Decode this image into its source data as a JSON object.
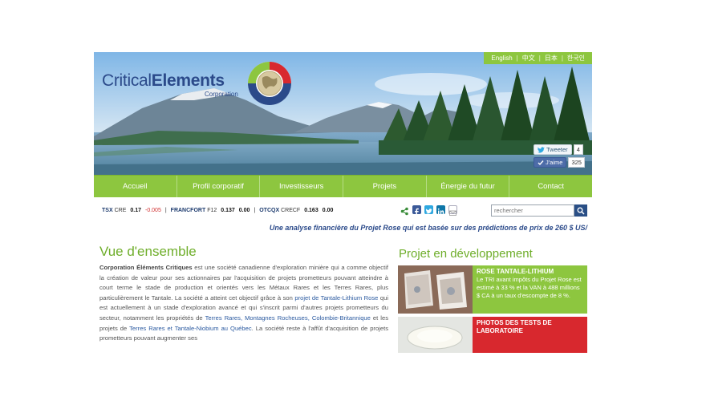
{
  "languages": [
    "English",
    "中文",
    "日本",
    "한국인"
  ],
  "logo": {
    "name_light": "Critical",
    "name_bold": "Elements",
    "subtitle": "Corporation"
  },
  "social": {
    "tweet_label": "Tweeter",
    "tweet_count": "4",
    "like_label": "J'aime",
    "like_count": "325"
  },
  "nav": [
    "Accueil",
    "Profil corporatif",
    "Investisseurs",
    "Projets",
    "Énergie du futur",
    "Contact"
  ],
  "ticker": {
    "tsx": {
      "exchange": "TSX",
      "symbol": "CRE",
      "price": "0.17",
      "change": "-0.005"
    },
    "frankfort": {
      "exchange": "FRANCFORT",
      "symbol": "F12",
      "price": "0.137",
      "change": "0.00"
    },
    "otcqx": {
      "exchange": "OTCQX",
      "symbol": "CRECF",
      "price": "0.163",
      "change": "0.00"
    }
  },
  "search": {
    "placeholder": "rechercher"
  },
  "announcement": "Une analyse financière du Projet Rose qui est basée sur des prédictions de prix de 260 $ US/",
  "overview": {
    "title": "Vue d'ensemble",
    "company": "Corporation Éléments Critiques",
    "p1": " est une société canadienne d'exploration minière qui a comme objectif la création de valeur pour ses actionnaires par l'acquisition de projets prometteurs pouvant atteindre à court terme le stade de production et orientés vers les Métaux Rares et les Terres Rares, plus particulièrement le Tantale. La société a atteint cet objectif grâce à son ",
    "link1": "projet de Tantale-Lithium Rose",
    "p2": " qui est actuellement à un stade d'exploration avancé et qui s'inscrit parmi d'autres projets prometteurs du secteur, notamment les propriétés de ",
    "link2": "Terres Rares, Montagnes Rocheuses, Colombie-Britannique",
    "p3": " et les projets de ",
    "link3": "Terres Rares et Tantale-Niobium au Québec",
    "p4": ". La société reste à l'affût d'acquisition de projets prometteurs pouvant augmenter ses"
  },
  "projects": {
    "title": "Projet en développement",
    "card1": {
      "title": "ROSE TANTALE-LITHIUM",
      "text": "Le TRI avant impôts du Projet Rose est estimé à 33 % et la VAN à 488 millions $ CA à un taux d'escompte de 8 %."
    },
    "card2": {
      "title": "PHOTOS DES TESTS DE LABORATOIRE"
    }
  },
  "colors": {
    "brand_green": "#8dc63f",
    "brand_blue": "#2b4a8a",
    "alert_red": "#d8282e"
  }
}
